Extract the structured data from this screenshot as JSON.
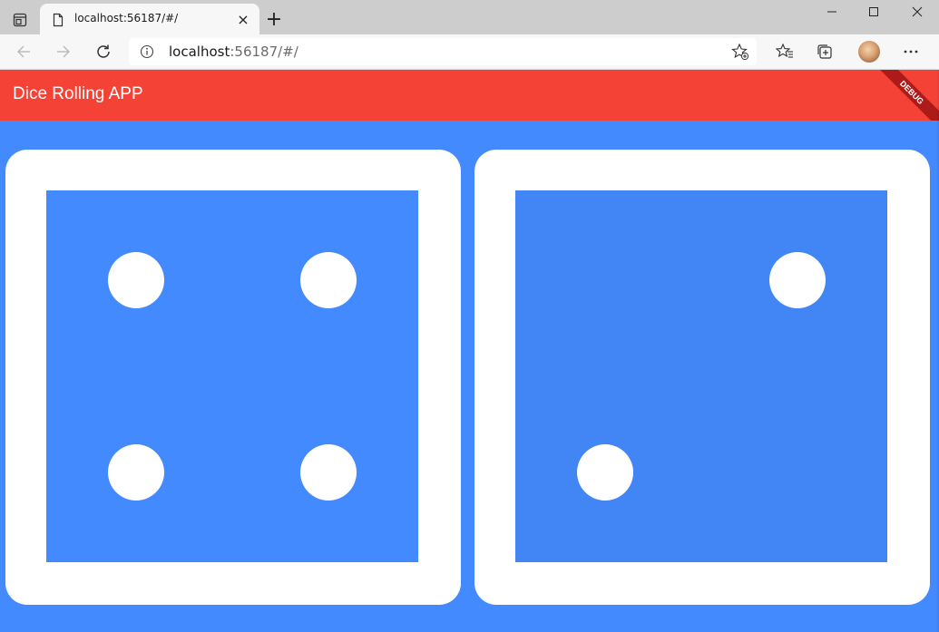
{
  "browser": {
    "tab_title": "localhost:56187/#/",
    "new_tab_symbol": "+",
    "close_tab_symbol": "×",
    "address": {
      "host": "localhost",
      "rest": ":56187/#/"
    },
    "icons": {
      "tab_actions": "tab-actions-icon",
      "favicon": "page-icon",
      "back": "back-arrow-icon",
      "forward": "forward-arrow-icon",
      "refresh": "refresh-icon",
      "info": "info-icon",
      "add_favorite": "add-favorite-icon",
      "favorites": "favorites-icon",
      "collections": "collections-icon",
      "more": "more-icon"
    }
  },
  "app": {
    "title": "Dice Rolling APP",
    "debug_label": "DEBUG",
    "colors": {
      "appbar": "#f44336",
      "background": "#448aff",
      "die_left_face": "#448aff",
      "die_right_face": "#4285f4"
    },
    "dice": [
      {
        "value": 4
      },
      {
        "value": 2
      }
    ]
  }
}
